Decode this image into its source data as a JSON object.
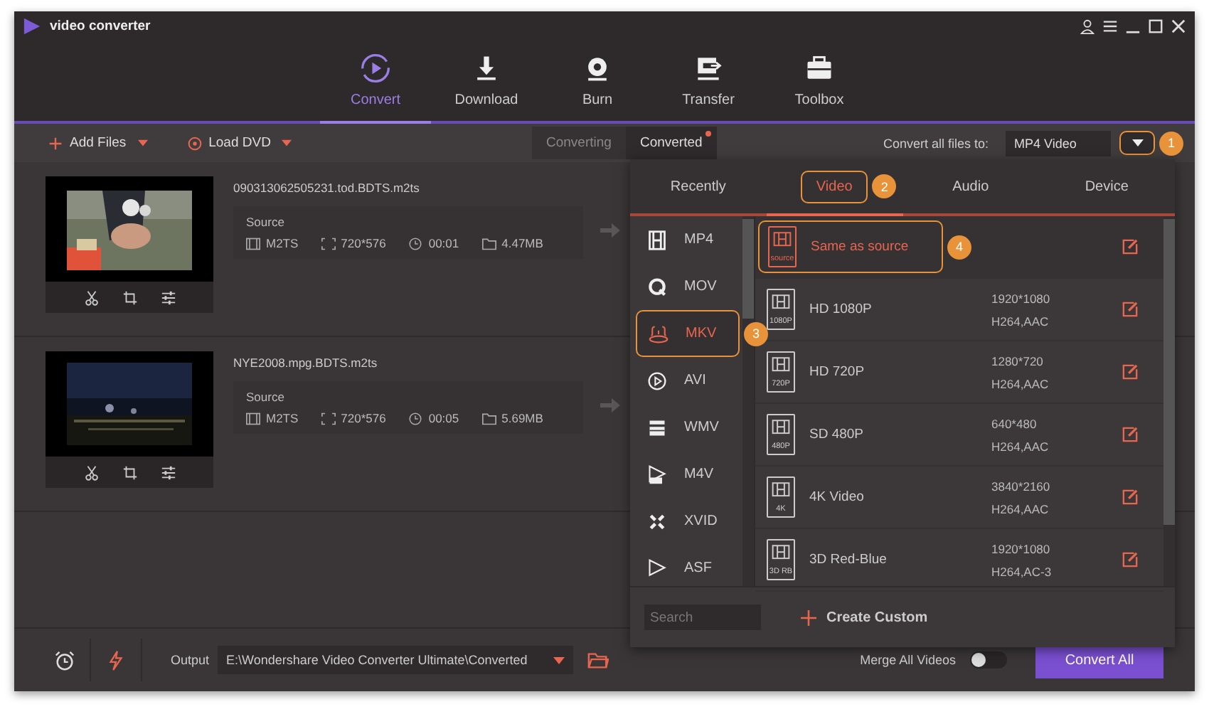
{
  "window": {
    "title": "video converter"
  },
  "nav": [
    {
      "label": "Convert",
      "selected": true
    },
    {
      "label": "Download",
      "selected": false
    },
    {
      "label": "Burn",
      "selected": false
    },
    {
      "label": "Transfer",
      "selected": false
    },
    {
      "label": "Toolbox",
      "selected": false
    }
  ],
  "toolbar": {
    "add_files": "Add Files",
    "load_dvd": "Load DVD",
    "tabs": [
      {
        "label": "Converting",
        "selected": false,
        "dot": false
      },
      {
        "label": "Converted",
        "selected": true,
        "dot": true
      }
    ],
    "convert_all_label": "Convert all files to:",
    "format": "MP4 Video",
    "callout": "1"
  },
  "files": [
    {
      "name": "090313062505231.tod.BDTS.m2ts",
      "source_label": "Source",
      "format": "M2TS",
      "resolution": "720*576",
      "duration": "00:01",
      "size": "4.47MB"
    },
    {
      "name": "NYE2008.mpg.BDTS.m2ts",
      "source_label": "Source",
      "format": "M2TS",
      "resolution": "720*576",
      "duration": "00:05",
      "size": "5.69MB"
    }
  ],
  "popup": {
    "tabs": [
      {
        "label": "Recently",
        "selected": false
      },
      {
        "label": "Video",
        "selected": true,
        "callout": "2"
      },
      {
        "label": "Audio",
        "selected": false
      },
      {
        "label": "Device",
        "selected": false
      }
    ],
    "formats": [
      {
        "label": "MP4",
        "selected": false
      },
      {
        "label": "MOV",
        "selected": false
      },
      {
        "label": "MKV",
        "selected": true,
        "callout": "3"
      },
      {
        "label": "AVI",
        "selected": false
      },
      {
        "label": "WMV",
        "selected": false
      },
      {
        "label": "M4V",
        "selected": false
      },
      {
        "label": "XVID",
        "selected": false
      },
      {
        "label": "ASF",
        "selected": false
      }
    ],
    "presets": [
      {
        "name": "Same as source",
        "badge": "source",
        "selected": true,
        "callout": "4"
      },
      {
        "name": "HD 1080P",
        "badge": "1080P",
        "resolution": "1920*1080",
        "codec": "H264,AAC",
        "selected": false
      },
      {
        "name": "HD 720P",
        "badge": "720P",
        "resolution": "1280*720",
        "codec": "H264,AAC",
        "selected": false
      },
      {
        "name": "SD 480P",
        "badge": "480P",
        "resolution": "640*480",
        "codec": "H264,AAC",
        "selected": false
      },
      {
        "name": "4K Video",
        "badge": "4K",
        "resolution": "3840*2160",
        "codec": "H264,AAC",
        "selected": false
      },
      {
        "name": "3D Red-Blue",
        "badge": "3D RB",
        "resolution": "1920*1080",
        "codec": "H264,AC-3",
        "selected": false
      }
    ],
    "search": {
      "placeholder": "Search"
    },
    "create_custom": "Create Custom"
  },
  "bottom": {
    "output_label": "Output",
    "output_path": "E:\\Wondershare Video Converter Ultimate\\Converted",
    "merge_label": "Merge All Videos",
    "merge_on": false,
    "convert_all": "Convert All"
  }
}
